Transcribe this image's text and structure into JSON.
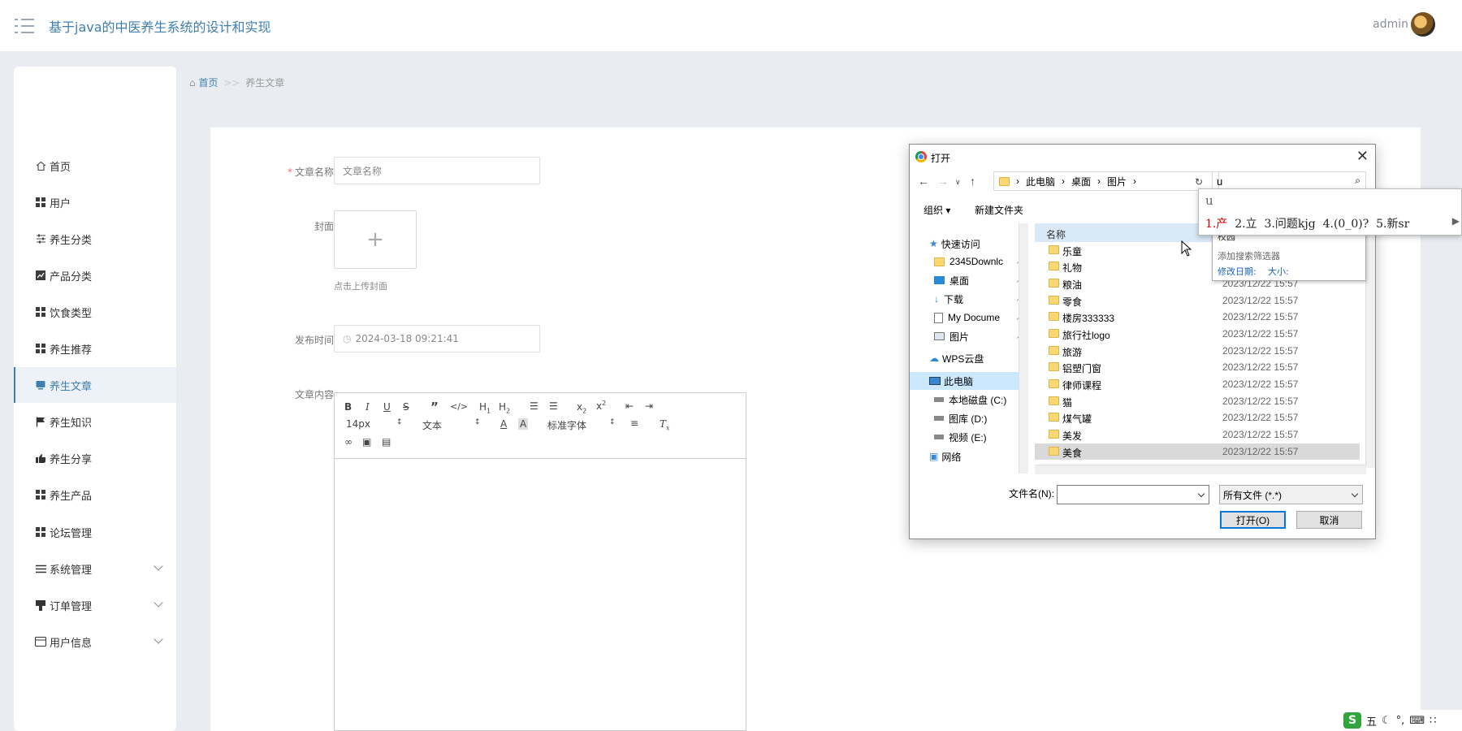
{
  "header": {
    "title": "基于java的中医养生系统的设计和实现",
    "user": "admin"
  },
  "sidebar": {
    "items": [
      {
        "label": "首页",
        "icon": "home-icon"
      },
      {
        "label": "用户",
        "icon": "grid-icon"
      },
      {
        "label": "养生分类",
        "icon": "sliders-icon"
      },
      {
        "label": "产品分类",
        "icon": "chart-icon"
      },
      {
        "label": "饮食类型",
        "icon": "grid-icon"
      },
      {
        "label": "养生推荐",
        "icon": "grid-icon"
      },
      {
        "label": "养生文章",
        "icon": "article-icon",
        "active": true
      },
      {
        "label": "养生知识",
        "icon": "flag-icon"
      },
      {
        "label": "养生分享",
        "icon": "share-icon"
      },
      {
        "label": "养生产品",
        "icon": "grid-icon"
      },
      {
        "label": "论坛管理",
        "icon": "grid-icon"
      },
      {
        "label": "系统管理",
        "icon": "list-icon",
        "expandable": true
      },
      {
        "label": "订单管理",
        "icon": "order-icon",
        "expandable": true
      },
      {
        "label": "用户信息",
        "icon": "card-icon",
        "expandable": true
      }
    ]
  },
  "breadcrumb": {
    "home": "首页",
    "sep": ">>",
    "current": "养生文章"
  },
  "form": {
    "title_label": "文章名称",
    "title_placeholder": "文章名称",
    "cover_label": "封面",
    "upload_plus": "+",
    "upload_tip": "点击上传封面",
    "time_label": "发布时间",
    "time_value": "2024-03-18 09:21:41",
    "content_label": "文章内容"
  },
  "editor": {
    "font_size": "14px",
    "block_format": "文本",
    "font_family": "标准字体"
  },
  "dialog": {
    "title": "打开",
    "path": [
      "此电脑",
      "桌面",
      "图片"
    ],
    "search_value": "u",
    "organize": "组织 ▾",
    "new_folder": "新建文件夹",
    "nav": [
      {
        "label": "快速访问",
        "icon": "star-icon"
      },
      {
        "label": "2345Downlc",
        "icon": "folder-icon",
        "pinned": true
      },
      {
        "label": "桌面",
        "icon": "desktop-icon",
        "pinned": true
      },
      {
        "label": "下载",
        "icon": "download-icon",
        "pinned": true
      },
      {
        "label": "My Docume",
        "icon": "document-icon",
        "pinned": true
      },
      {
        "label": "图片",
        "icon": "picture-icon",
        "pinned": true
      },
      {
        "label": "WPS云盘",
        "icon": "cloud-icon"
      },
      {
        "label": "此电脑",
        "icon": "computer-icon",
        "selected": true
      },
      {
        "label": "本地磁盘 (C:)",
        "icon": "drive-icon"
      },
      {
        "label": "图库 (D:)",
        "icon": "drive-icon"
      },
      {
        "label": "视频 (E:)",
        "icon": "drive-icon"
      },
      {
        "label": "网络",
        "icon": "network-icon"
      }
    ],
    "col_name": "名称",
    "files": [
      {
        "name": "乐童",
        "date": ""
      },
      {
        "name": "礼物",
        "date": ""
      },
      {
        "name": "粮油",
        "date": "2023/12/22 15:57"
      },
      {
        "name": "零食",
        "date": "2023/12/22 15:57"
      },
      {
        "name": "楼房333333",
        "date": "2023/12/22 15:57"
      },
      {
        "name": "旅行社logo",
        "date": "2023/12/22 15:57"
      },
      {
        "name": "旅游",
        "date": "2023/12/22 15:57"
      },
      {
        "name": "铝塑门窗",
        "date": "2023/12/22 15:57"
      },
      {
        "name": "律师课程",
        "date": "2023/12/22 15:57"
      },
      {
        "name": "猫",
        "date": "2023/12/22 15:57"
      },
      {
        "name": "煤气罐",
        "date": "2023/12/22 15:57"
      },
      {
        "name": "美发",
        "date": "2023/12/22 15:57"
      },
      {
        "name": "美食",
        "date": "2023/12/22 15:57",
        "selected": true
      }
    ],
    "search_popup": {
      "line1": "校园",
      "filter": "添加搜索筛选器",
      "date": "修改日期:",
      "size": "大小:"
    },
    "filename_label": "文件名(N):",
    "filetype": "所有文件 (*.*)",
    "open_btn": "打开(O)",
    "cancel_btn": "取消"
  },
  "ime": {
    "input": "u",
    "candidates": [
      "1.产",
      "2.立",
      "3.问题kjg",
      "4.(0_0)?",
      "5.新sr"
    ]
  },
  "tray": {
    "ime_label": "五"
  }
}
